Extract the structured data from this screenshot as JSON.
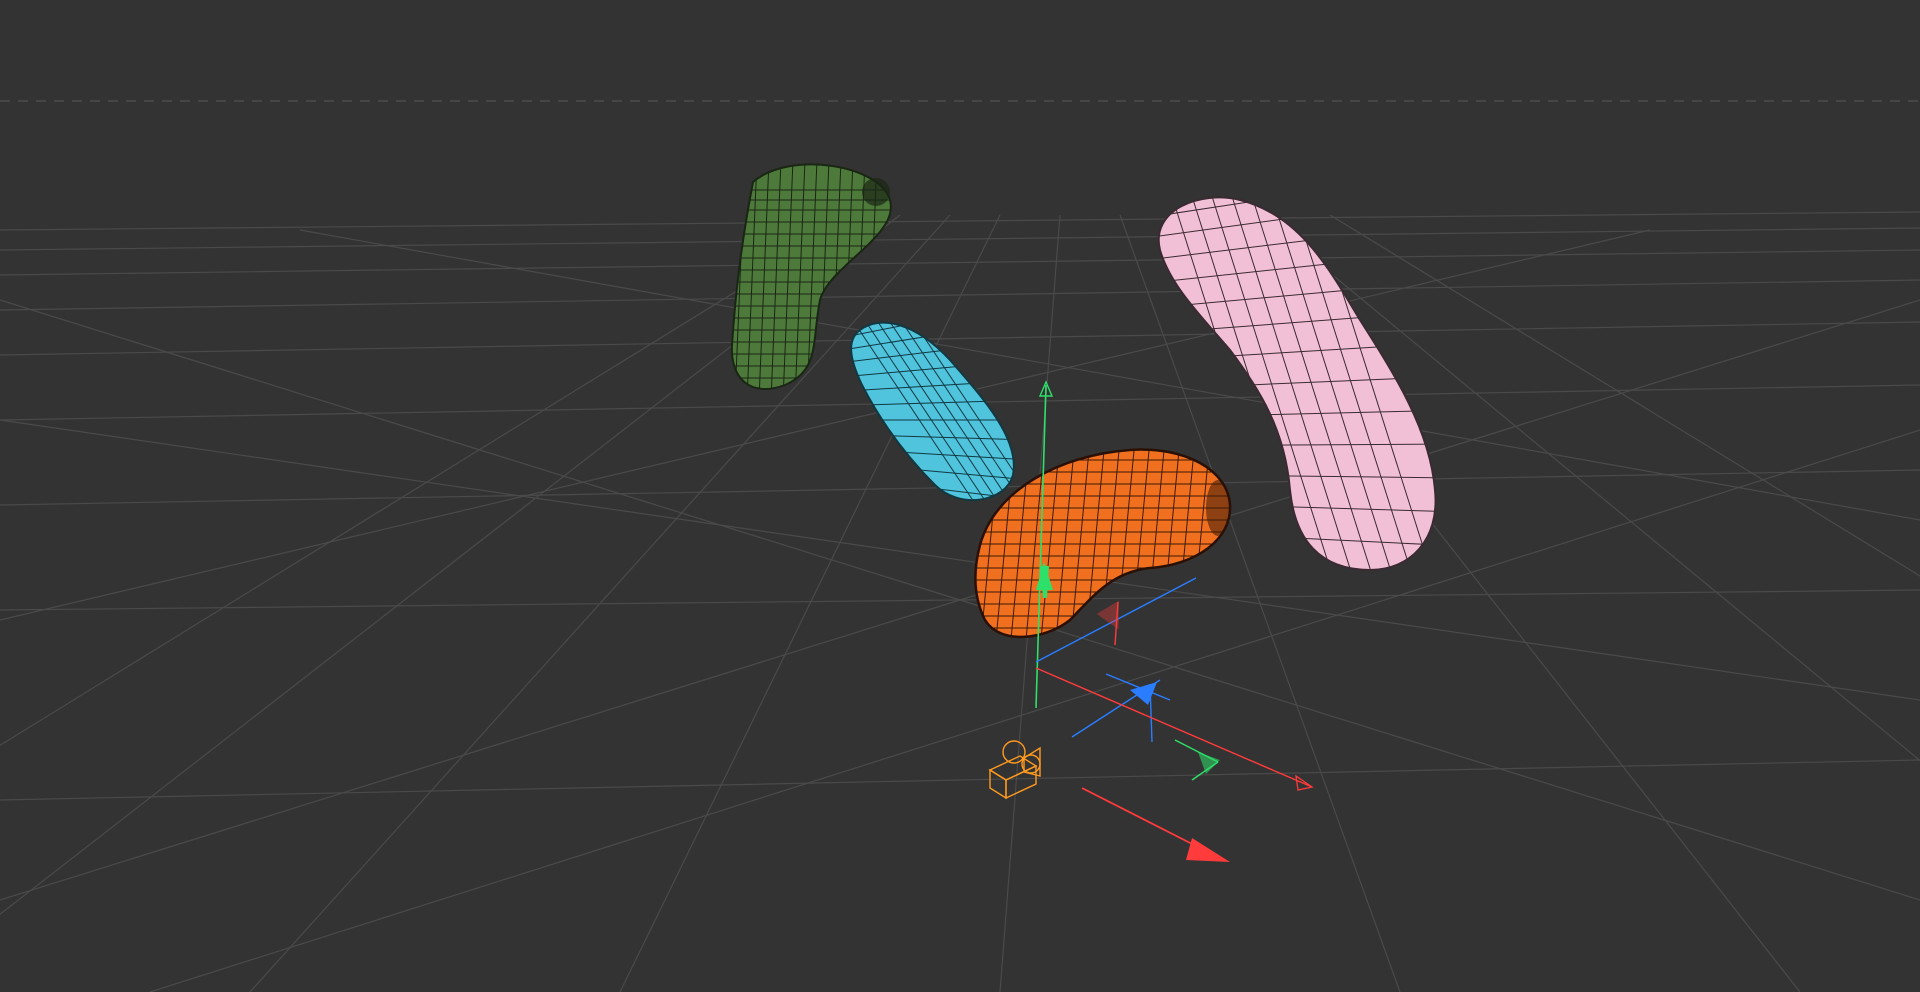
{
  "viewport": {
    "background_color": "#333333",
    "grid_color": "#4a4a4a",
    "horizon_color": "#5a5a5a",
    "view": "3D perspective",
    "grid": true
  },
  "objects": [
    {
      "name": "green-bent-capsule",
      "color": "#4d7a3a",
      "wire_color": "#1a2614",
      "selected": false
    },
    {
      "name": "cyan-bent-capsule",
      "color": "#4fc4dc",
      "wire_color": "#123842",
      "selected": false
    },
    {
      "name": "orange-bent-capsule",
      "color": "#f0701f",
      "wire_color": "#3d1a06",
      "selected": true
    },
    {
      "name": "pink-bent-capsule",
      "color": "#f2c0d6",
      "wire_color": "#3a2a32",
      "selected": false
    }
  ],
  "gizmo": {
    "x_axis_color": "#ff3b3b",
    "y_axis_color": "#2ee06a",
    "z_axis_color": "#2a7dff"
  },
  "camera": {
    "icon": "camera-icon",
    "color": "#ff9a1f"
  }
}
